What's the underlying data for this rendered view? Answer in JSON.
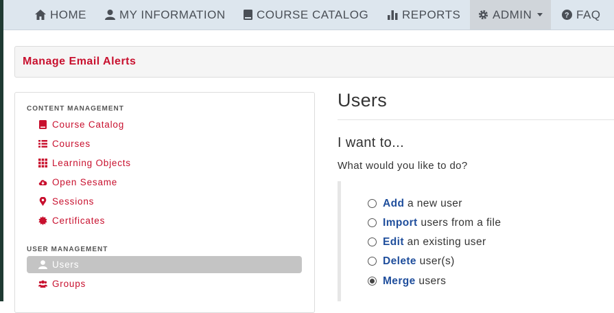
{
  "nav": {
    "home": "HOME",
    "my_information": "MY INFORMATION",
    "course_catalog": "COURSE CATALOG",
    "reports": "REPORTS",
    "admin": "ADMIN",
    "faq": "FAQ"
  },
  "page_title": "Manage Email Alerts",
  "sidebar": {
    "content_section": "CONTENT MANAGEMENT",
    "content_items": [
      {
        "label": "Course Catalog",
        "icon": "book-icon"
      },
      {
        "label": "Courses",
        "icon": "list-icon"
      },
      {
        "label": "Learning Objects",
        "icon": "grid-icon"
      },
      {
        "label": "Open Sesame",
        "icon": "cloud-download-icon"
      },
      {
        "label": "Sessions",
        "icon": "map-marker-icon"
      },
      {
        "label": "Certificates",
        "icon": "certificate-icon"
      }
    ],
    "user_section": "USER MANAGEMENT",
    "user_items": [
      {
        "label": "Users",
        "icon": "user-icon",
        "selected": true
      },
      {
        "label": "Groups",
        "icon": "users-icon"
      }
    ]
  },
  "main": {
    "heading": "Users",
    "subheading": "I want to...",
    "question": "What would you like to do?",
    "options": [
      {
        "verb": "Add",
        "rest": " a new user",
        "checked": false
      },
      {
        "verb": "Import",
        "rest": " users from a file",
        "checked": false
      },
      {
        "verb": "Edit",
        "rest": " an existing user",
        "checked": false
      },
      {
        "verb": "Delete",
        "rest": " user(s)",
        "checked": false
      },
      {
        "verb": "Merge",
        "rest": " users",
        "checked": true
      }
    ]
  },
  "colors": {
    "accent_red": "#c8102e",
    "link_blue": "#1f4e9c",
    "nav_bg": "#dde6ee",
    "selected_bg": "#c4c4c4"
  }
}
